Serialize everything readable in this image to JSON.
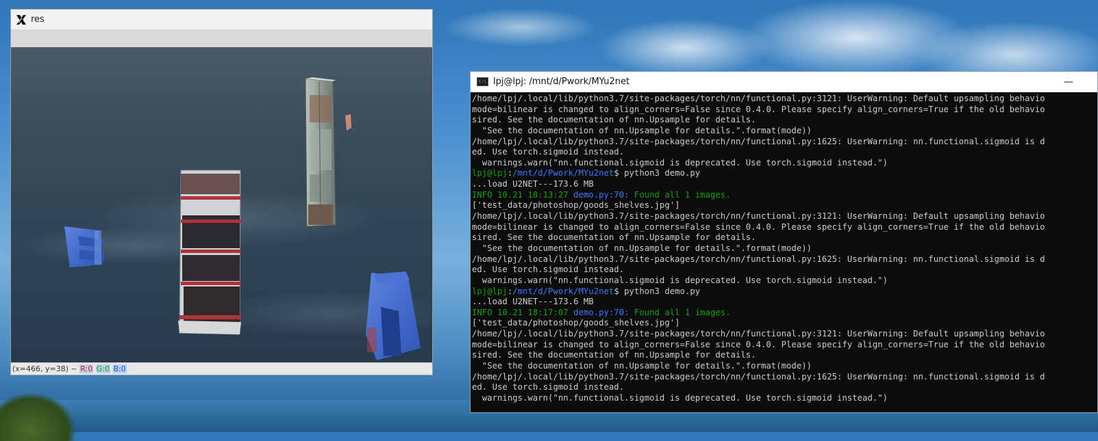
{
  "res_window": {
    "title": "res",
    "status": {
      "coords": "(x=466, y=38) ~",
      "r_label": "R:0",
      "g_label": "G:0",
      "b_label": "B:0"
    }
  },
  "terminal": {
    "title": "lpj@lpj: /mnt/d/Pwork/MYu2net",
    "minimize_label": "—",
    "lines": [
      [
        {
          "t": "/home/lpj/.local/lib/python3.7/site-packages/torch/nn/functional.py:3121: UserWarning: Default upsampling behavio",
          "c": "white"
        }
      ],
      [
        {
          "t": "mode=bilinear is changed to align_corners=False since 0.4.0. Please specify align_corners=True if the old behavio",
          "c": "white"
        }
      ],
      [
        {
          "t": "sired. See the documentation of nn.Upsample for details.",
          "c": "white"
        }
      ],
      [
        {
          "t": "  \"See the documentation of nn.Upsample for details.\".format(mode))",
          "c": "white"
        }
      ],
      [
        {
          "t": "/home/lpj/.local/lib/python3.7/site-packages/torch/nn/functional.py:1625: UserWarning: nn.functional.sigmoid is d",
          "c": "white"
        }
      ],
      [
        {
          "t": "ed. Use torch.sigmoid instead.",
          "c": "white"
        }
      ],
      [
        {
          "t": "  warnings.warn(\"nn.functional.sigmoid is deprecated. Use torch.sigmoid instead.\")",
          "c": "white"
        }
      ],
      [
        {
          "t": "lpj@lpj",
          "c": "green"
        },
        {
          "t": ":",
          "c": "white"
        },
        {
          "t": "/mnt/d/Pwork/MYu2net",
          "c": "blue"
        },
        {
          "t": "$ python3 demo.py",
          "c": "white"
        }
      ],
      [
        {
          "t": "...load U2NET---173.6 MB",
          "c": "white"
        }
      ],
      [
        {
          "t": "INFO 10.21 18:13:27 ",
          "c": "green"
        },
        {
          "t": "demo.py:70: ",
          "c": "blue"
        },
        {
          "t": "Found all 1 images.",
          "c": "green"
        }
      ],
      [
        {
          "t": "['test_data/photoshop/goods_shelves.jpg']",
          "c": "white"
        }
      ],
      [
        {
          "t": "/home/lpj/.local/lib/python3.7/site-packages/torch/nn/functional.py:3121: UserWarning: Default upsampling behavio",
          "c": "white"
        }
      ],
      [
        {
          "t": "mode=bilinear is changed to align_corners=False since 0.4.0. Please specify align_corners=True if the old behavio",
          "c": "white"
        }
      ],
      [
        {
          "t": "sired. See the documentation of nn.Upsample for details.",
          "c": "white"
        }
      ],
      [
        {
          "t": "  \"See the documentation of nn.Upsample for details.\".format(mode))",
          "c": "white"
        }
      ],
      [
        {
          "t": "/home/lpj/.local/lib/python3.7/site-packages/torch/nn/functional.py:1625: UserWarning: nn.functional.sigmoid is d",
          "c": "white"
        }
      ],
      [
        {
          "t": "ed. Use torch.sigmoid instead.",
          "c": "white"
        }
      ],
      [
        {
          "t": "  warnings.warn(\"nn.functional.sigmoid is deprecated. Use torch.sigmoid instead.\")",
          "c": "white"
        }
      ],
      [
        {
          "t": "lpj@lpj",
          "c": "green"
        },
        {
          "t": ":",
          "c": "white"
        },
        {
          "t": "/mnt/d/Pwork/MYu2net",
          "c": "blue"
        },
        {
          "t": "$ python3 demo.py",
          "c": "white"
        }
      ],
      [
        {
          "t": "...load U2NET---173.6 MB",
          "c": "white"
        }
      ],
      [
        {
          "t": "INFO 10.21 18:17:07 ",
          "c": "green"
        },
        {
          "t": "demo.py:70: ",
          "c": "blue"
        },
        {
          "t": "Found all 1 images.",
          "c": "green"
        }
      ],
      [
        {
          "t": "['test_data/photoshop/goods_shelves.jpg']",
          "c": "white"
        }
      ],
      [
        {
          "t": "/home/lpj/.local/lib/python3.7/site-packages/torch/nn/functional.py:3121: UserWarning: Default upsampling behavio",
          "c": "white"
        }
      ],
      [
        {
          "t": "mode=bilinear is changed to align_corners=False since 0.4.0. Please specify align_corners=True if the old behavio",
          "c": "white"
        }
      ],
      [
        {
          "t": "sired. See the documentation of nn.Upsample for details.",
          "c": "white"
        }
      ],
      [
        {
          "t": "  \"See the documentation of nn.Upsample for details.\".format(mode))",
          "c": "white"
        }
      ],
      [
        {
          "t": "/home/lpj/.local/lib/python3.7/site-packages/torch/nn/functional.py:1625: UserWarning: nn.functional.sigmoid is d",
          "c": "white"
        }
      ],
      [
        {
          "t": "ed. Use torch.sigmoid instead.",
          "c": "white"
        }
      ],
      [
        {
          "t": "  warnings.warn(\"nn.functional.sigmoid is deprecated. Use torch.sigmoid instead.\")",
          "c": "white"
        }
      ]
    ]
  },
  "colors": {
    "term_green": "#13a10e",
    "term_blue": "#3b78ff",
    "term_text": "#cccccc"
  }
}
